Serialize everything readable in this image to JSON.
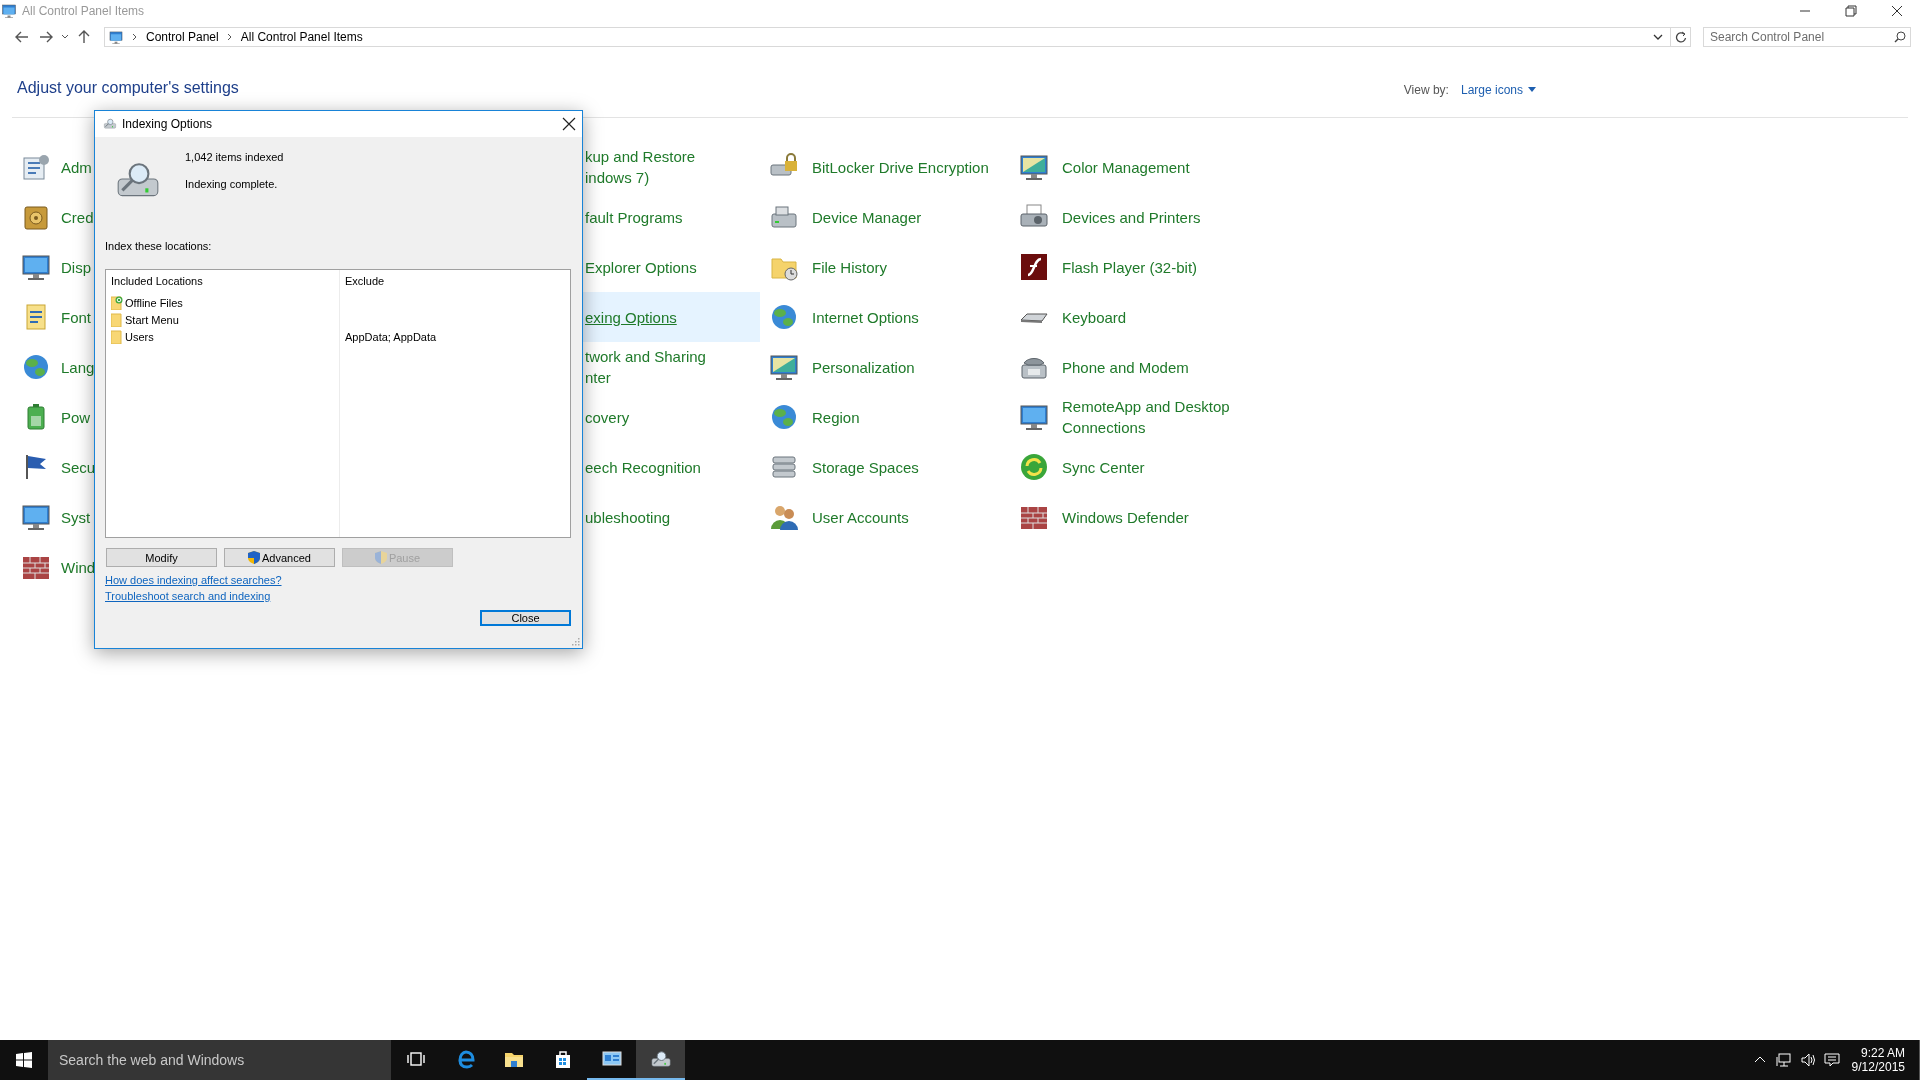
{
  "window": {
    "title": "All Control Panel Items"
  },
  "address_bar": {
    "breadcrumb": [
      "Control Panel",
      "All Control Panel Items"
    ]
  },
  "search": {
    "placeholder": "Search Control Panel"
  },
  "heading": "Adjust your computer's settings",
  "view_by": {
    "label": "View by:",
    "value": "Large icons"
  },
  "columns": [
    {
      "icons_visible": true,
      "items": [
        {
          "lines": [
            "Adm"
          ],
          "selected": false
        },
        {
          "lines": [
            "Cred"
          ],
          "selected": false
        },
        {
          "lines": [
            "Disp"
          ],
          "selected": false
        },
        {
          "lines": [
            "Font"
          ],
          "selected": false
        },
        {
          "lines": [
            "Lang"
          ],
          "selected": false
        },
        {
          "lines": [
            "Pow"
          ],
          "selected": false
        },
        {
          "lines": [
            "Secu"
          ],
          "selected": false
        },
        {
          "lines": [
            "Syst"
          ],
          "selected": false
        },
        {
          "lines": [
            "Wind"
          ],
          "selected": false
        }
      ]
    },
    {
      "icons_visible": false,
      "items": [
        {
          "lines": [
            "kup and Restore",
            "indows 7)"
          ],
          "selected": false
        },
        {
          "lines": [
            "fault Programs"
          ],
          "selected": false
        },
        {
          "lines": [
            "Explorer Options"
          ],
          "selected": false
        },
        {
          "lines": [
            "exing Options"
          ],
          "selected": true
        },
        {
          "lines": [
            "twork and Sharing",
            "nter"
          ],
          "selected": false
        },
        {
          "lines": [
            "covery"
          ],
          "selected": false
        },
        {
          "lines": [
            "eech Recognition"
          ],
          "selected": false
        },
        {
          "lines": [
            "ubleshooting"
          ],
          "selected": false
        }
      ]
    },
    {
      "icons_visible": true,
      "items": [
        {
          "lines": [
            "BitLocker Drive Encryption"
          ],
          "selected": false
        },
        {
          "lines": [
            "Device Manager"
          ],
          "selected": false
        },
        {
          "lines": [
            "File History"
          ],
          "selected": false
        },
        {
          "lines": [
            "Internet Options"
          ],
          "selected": false
        },
        {
          "lines": [
            "Personalization"
          ],
          "selected": false
        },
        {
          "lines": [
            "Region"
          ],
          "selected": false
        },
        {
          "lines": [
            "Storage Spaces"
          ],
          "selected": false
        },
        {
          "lines": [
            "User Accounts"
          ],
          "selected": false
        }
      ]
    },
    {
      "icons_visible": true,
      "items": [
        {
          "lines": [
            "Color Management"
          ],
          "selected": false
        },
        {
          "lines": [
            "Devices and Printers"
          ],
          "selected": false
        },
        {
          "lines": [
            "Flash Player (32-bit)"
          ],
          "selected": false
        },
        {
          "lines": [
            "Keyboard"
          ],
          "selected": false
        },
        {
          "lines": [
            "Phone and Modem"
          ],
          "selected": false
        },
        {
          "lines": [
            "RemoteApp and Desktop",
            "Connections"
          ],
          "selected": false
        },
        {
          "lines": [
            "Sync Center"
          ],
          "selected": false
        },
        {
          "lines": [
            "Windows Defender"
          ],
          "selected": false
        }
      ]
    }
  ],
  "dialog": {
    "title": "Indexing Options",
    "items_indexed": "1,042 items indexed",
    "status": "Indexing complete.",
    "locations_label": "Index these locations:",
    "table": {
      "columns": [
        "Included Locations",
        "Exclude"
      ],
      "rows": [
        {
          "location": "Offline Files",
          "kind": "offline"
        },
        {
          "location": "Start Menu",
          "kind": "folder"
        },
        {
          "location": "Users",
          "kind": "folder",
          "exclude": "AppData; AppData"
        }
      ]
    },
    "buttons": [
      {
        "label": "Modify",
        "disabled": false,
        "shield": false
      },
      {
        "label": "Advanced",
        "disabled": false,
        "shield": true
      },
      {
        "label": "Pause",
        "disabled": true,
        "shield": true
      }
    ],
    "links": [
      "How does indexing affect searches?",
      "Troubleshoot search and indexing"
    ],
    "close_button": {
      "label": "Close",
      "default": true
    }
  },
  "taskbar": {
    "search": {
      "placeholder": "Search the web and Windows"
    },
    "apps": [
      {
        "kind": "task-view",
        "active": false,
        "focused": false
      },
      {
        "kind": "browser",
        "active": false,
        "focused": false
      },
      {
        "kind": "file-explorer",
        "active": false,
        "focused": false
      },
      {
        "kind": "store",
        "active": false,
        "focused": false
      },
      {
        "kind": "control-panel",
        "active": true,
        "focused": false
      },
      {
        "kind": "indexing",
        "active": true,
        "focused": true
      }
    ],
    "clock": {
      "time": "9:22 AM",
      "date": "9/12/2015"
    }
  }
}
